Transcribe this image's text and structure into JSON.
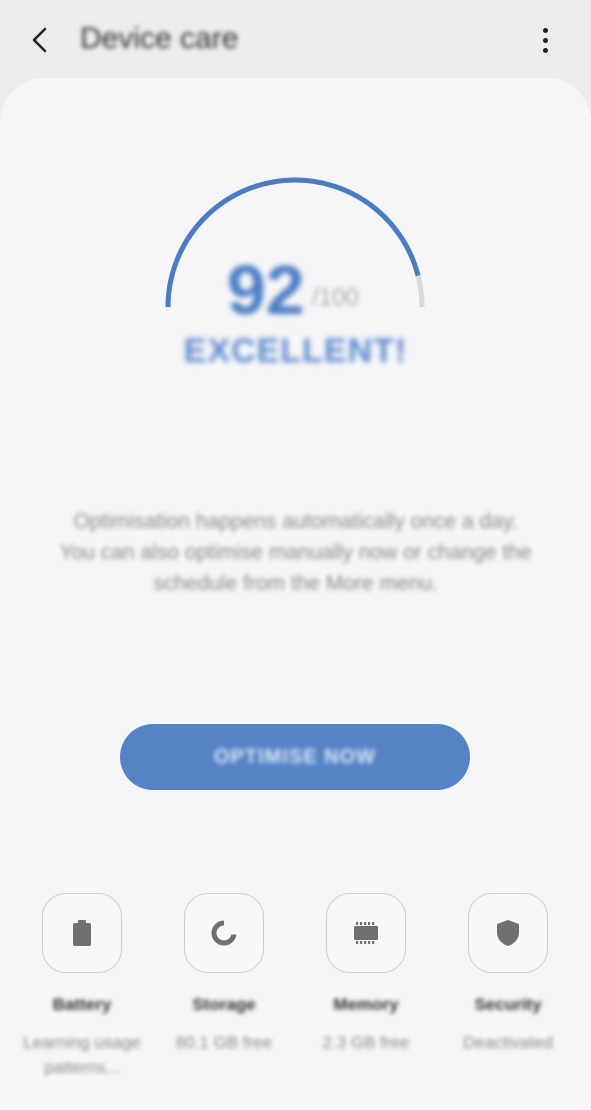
{
  "header": {
    "title": "Device care"
  },
  "score": {
    "value": "92",
    "max": "/100",
    "fraction": 0.92,
    "status": "EXCELLENT!",
    "accent_color": "#4a7cc4"
  },
  "description": {
    "line1": "Optimisation happens automatically once a day.",
    "line2": "You can also optimise manually now or change the",
    "line3": "schedule from the More menu."
  },
  "optimize_button": {
    "label": "OPTIMISE NOW",
    "color": "#5484c6"
  },
  "categories": [
    {
      "label": "Battery",
      "sub": "Learning usage patterns...",
      "icon": "battery-icon"
    },
    {
      "label": "Storage",
      "sub": "80.1 GB free",
      "icon": "storage-icon"
    },
    {
      "label": "Memory",
      "sub": "2.3 GB free",
      "icon": "memory-icon"
    },
    {
      "label": "Security",
      "sub": "Deactivated",
      "icon": "shield-icon"
    }
  ]
}
